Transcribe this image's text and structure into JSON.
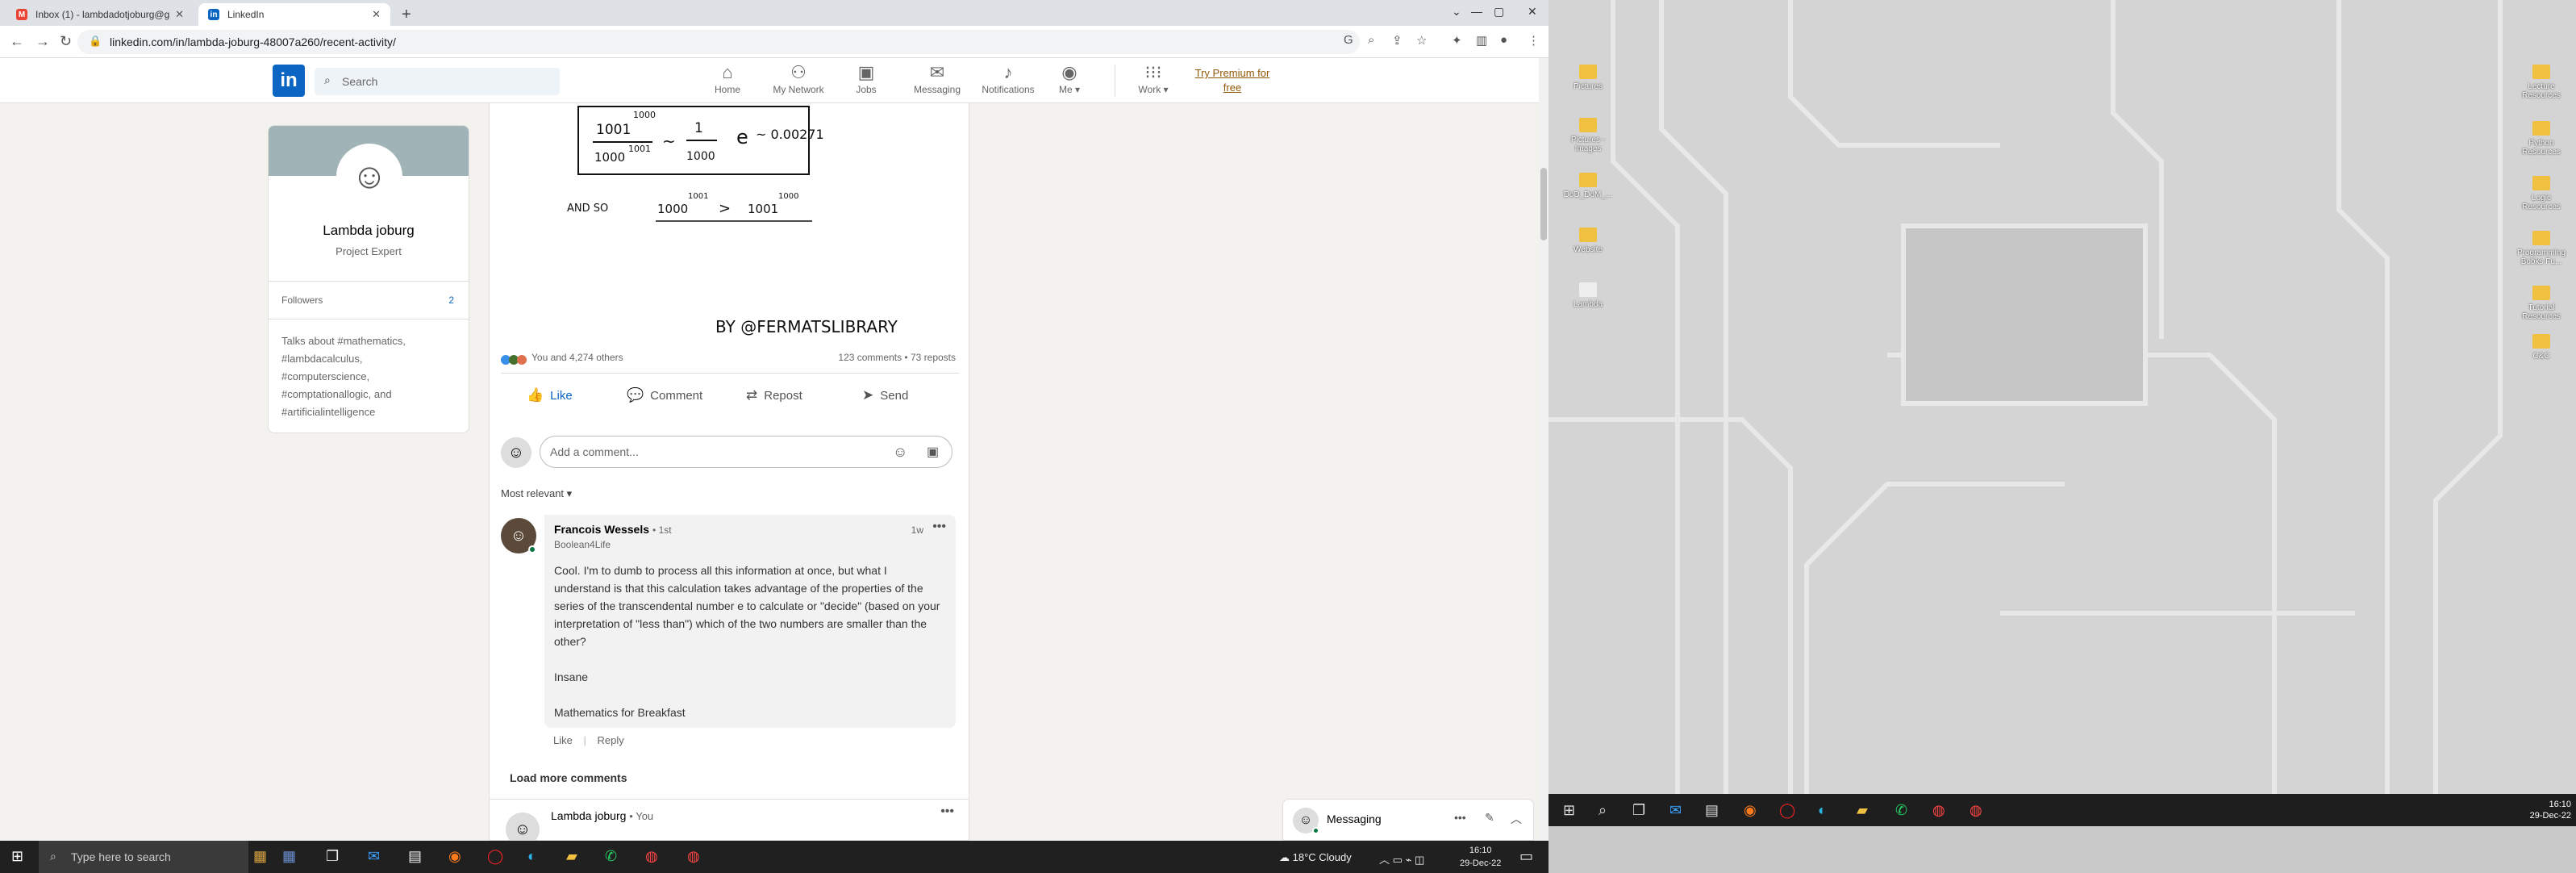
{
  "browser": {
    "tabs": [
      {
        "title": "Inbox (1) - lambdadotjoburg@g",
        "active": false
      },
      {
        "title": "LinkedIn",
        "active": true
      }
    ],
    "url": "linkedin.com/in/lambda-joburg-48007a260/recent-activity/"
  },
  "header": {
    "search_placeholder": "Search",
    "nav": [
      "Home",
      "My Network",
      "Jobs",
      "Messaging",
      "Notifications",
      "Me",
      "Work"
    ],
    "premium": [
      "Try Premium for",
      "free"
    ]
  },
  "profile": {
    "name": "Lambda joburg",
    "title": "Project Expert",
    "followers_label": "Followers",
    "followers_count": "2",
    "talks_about": "Talks about #mathematics, #lambdacalculus, #computerscience, #comptationallogic, and #artificialintelligence"
  },
  "post": {
    "math": {
      "frac_num": "1001",
      "frac_num_exp": "1000",
      "frac_den": "1000",
      "frac_den_exp": "1001",
      "approx": "~",
      "one": "1",
      "thousand": "1000",
      "e": "e",
      "result": "~ 0.00271",
      "and_so": "AND SO",
      "lhs": "1000",
      "lhs_exp": "1001",
      "gt": ">",
      "rhs": "1001",
      "rhs_exp": "1000",
      "credit": "BY @FERMATSLIBRARY"
    },
    "reactions": "You and 4,274 others",
    "stats": "123 comments • 73 reposts",
    "actions": [
      "Like",
      "Comment",
      "Repost",
      "Send"
    ],
    "comment_placeholder": "Add a comment...",
    "sort": "Most relevant"
  },
  "comment": {
    "author": "Francois Wessels",
    "degree": "• 1st",
    "subtitle": "Boolean4Life",
    "time": "1w",
    "text": "Cool. I'm to dumb to process all this information at once, but what I understand is that this calculation takes advantage of the properties of the series of the transcendental number e to calculate or \"decide\" (based on your interpretation of \"less than\") which of the two numbers are smaller than the other?\n\nInsane\n\nMathematics for Breakfast",
    "like": "Like",
    "reply": "Reply"
  },
  "load_more": "Load more comments",
  "next_post": {
    "author": "Lambda joburg",
    "you": "• You"
  },
  "messaging": {
    "title": "Messaging"
  },
  "desktop": {
    "left_icons": [
      "Pictures",
      "Pictures - Images",
      "DoD_DoM_...",
      "Website",
      "Lambda"
    ],
    "right_icons": [
      "Lecture Resources",
      "Python Resources",
      "Logic Resources",
      "Programming Books Fu...",
      "Tutorial Resources",
      "C&C"
    ],
    "time": "16:10",
    "date": "29-Dec-22"
  },
  "windows_taskbar": {
    "search_placeholder": "Type here to search",
    "weather": "18°C  Cloudy",
    "time": "16:10",
    "date": "29-Dec-22"
  }
}
